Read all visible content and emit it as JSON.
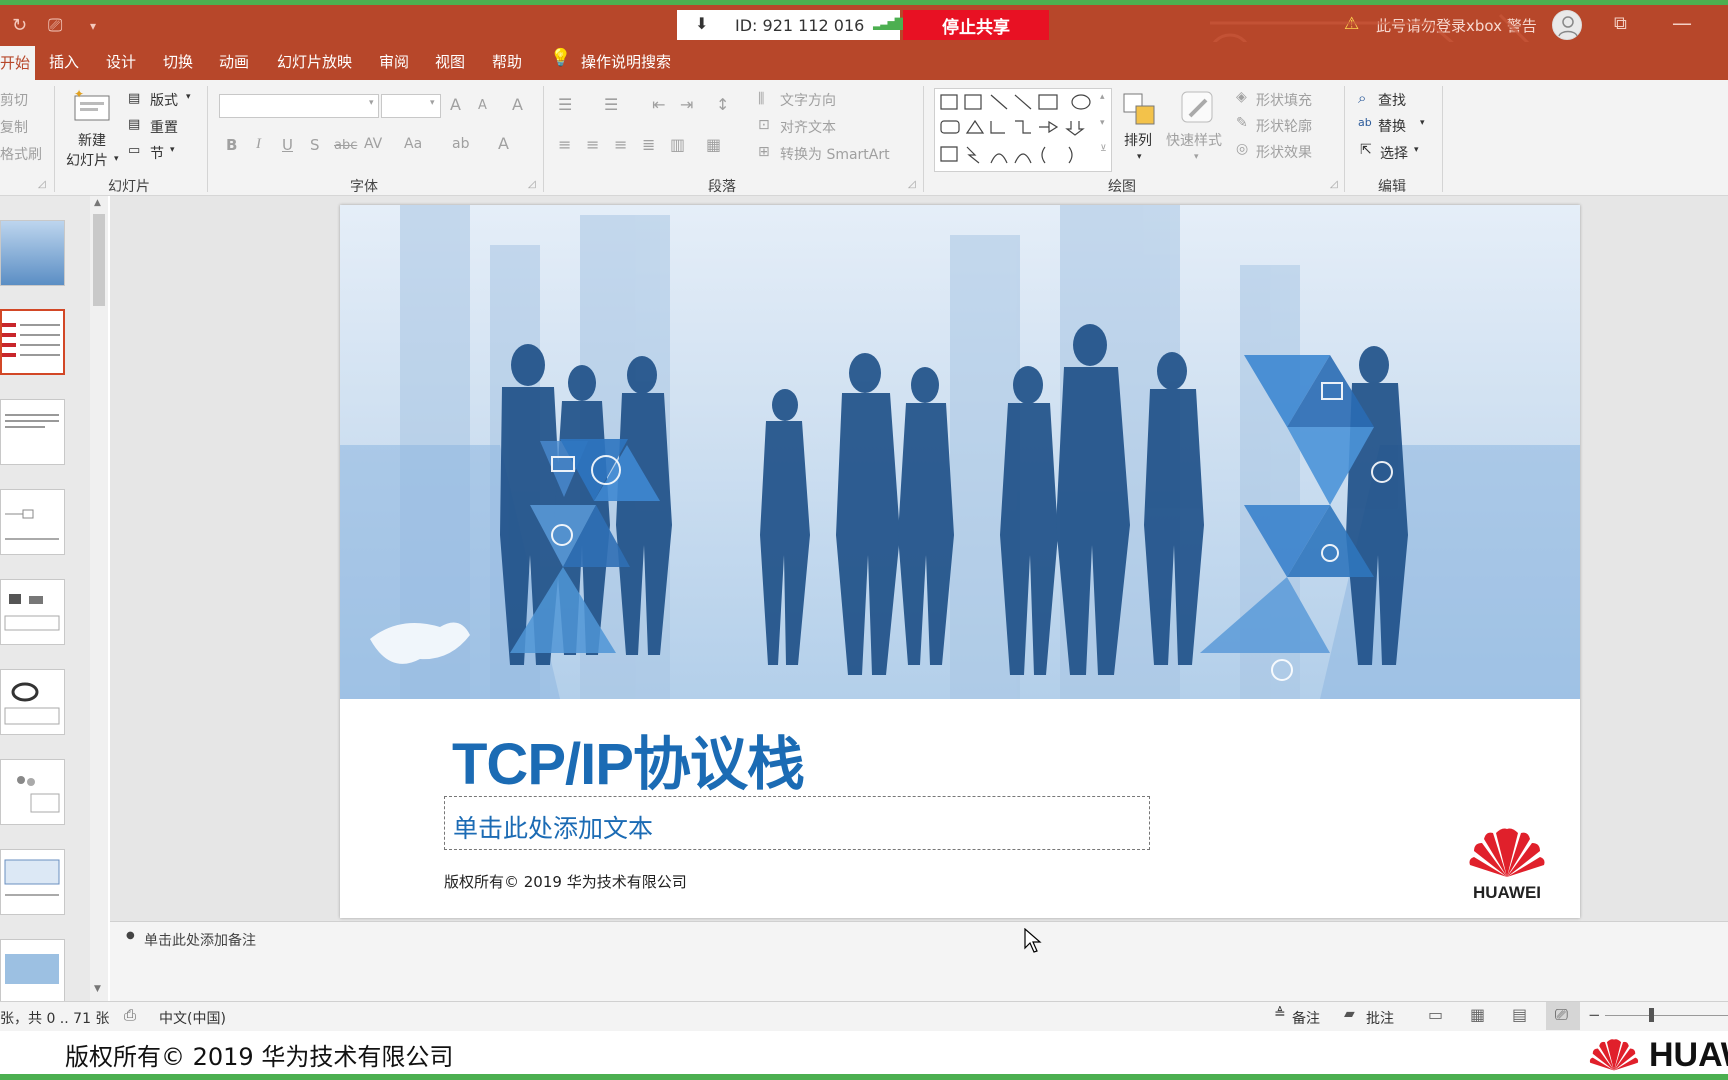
{
  "titlebar": {
    "share_id": "ID: 921 112 016",
    "stop_share": "停止共享",
    "warning": "此号请勿登录xbox 警告"
  },
  "menu": {
    "tabs": [
      "开始",
      "插入",
      "设计",
      "切换",
      "动画",
      "幻灯片放映",
      "审阅",
      "视图",
      "帮助",
      "操作说明搜索"
    ]
  },
  "ribbon": {
    "clipboard": {
      "cut": "剪切",
      "copy": "复制",
      "format_painter": "格式刷"
    },
    "slides": {
      "new_slide_line1": "新建",
      "new_slide_line2": "幻灯片",
      "layout": "版式",
      "reset": "重置",
      "section": "节",
      "label": "幻灯片"
    },
    "font": {
      "label": "字体",
      "bold": "B",
      "italic": "I",
      "underline": "U",
      "shadow": "S",
      "strike": "abc",
      "spacing": "AV",
      "case": "Aa",
      "grow": "A",
      "shrink": "A",
      "clear": "A",
      "color": "A"
    },
    "paragraph": {
      "label": "段落",
      "text_direction": "文字方向",
      "align_text": "对齐文本",
      "convert_smartart": "转换为 SmartArt"
    },
    "drawing": {
      "label": "绘图",
      "arrange": "排列",
      "quick_styles": "快速样式",
      "shape_fill": "形状填充",
      "shape_outline": "形状轮廓",
      "shape_effects": "形状效果"
    },
    "editing": {
      "label": "编辑",
      "find": "查找",
      "replace": "替换",
      "select": "选择"
    }
  },
  "slide": {
    "title": "TCP/IP协议栈",
    "subtitle_placeholder": "单击此处添加文本",
    "copyright": "版权所有© 2019 华为技术有限公司",
    "logo_text": "HUAWEI"
  },
  "notes": {
    "placeholder": "单击此处添加备注"
  },
  "statusbar": {
    "slide_counter": "张，共 0 .. 71 张",
    "language": "中文(中国)",
    "notes_btn": "备注",
    "comments_btn": "批注"
  },
  "bottom": {
    "copyright": "版权所有© 2019 华为技术有限公司",
    "logo_text": "HUAW"
  },
  "colors": {
    "accent": "#b7472a",
    "title_blue": "#1b6bb4",
    "stop_red": "#e81123",
    "huawei_red": "#e0202b"
  }
}
